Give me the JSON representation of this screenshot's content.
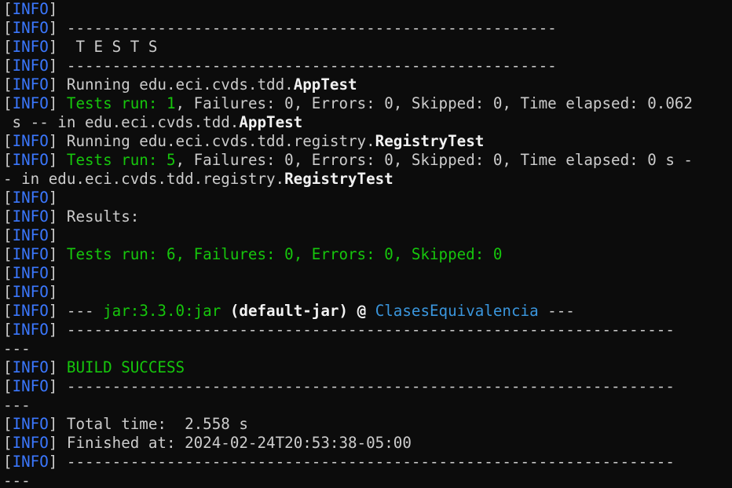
{
  "window": {
    "title": ""
  },
  "log_tag": "INFO",
  "colors": {
    "background": "#0c0c0c",
    "default_text": "#cccccc",
    "bright_text": "#f2f2f2",
    "info_tag": "#3b78ff",
    "success_green": "#16c60c",
    "artifact_cyan": "#3a96dd"
  },
  "lines": [
    {
      "tag": true,
      "segments": []
    },
    {
      "tag": true,
      "segments": [
        {
          "text": " ------------------------------------------------------",
          "style": "default"
        }
      ]
    },
    {
      "tag": true,
      "segments": [
        {
          "text": "  T E S T S",
          "style": "default"
        }
      ]
    },
    {
      "tag": true,
      "segments": [
        {
          "text": " ------------------------------------------------------",
          "style": "default"
        }
      ]
    },
    {
      "tag": true,
      "segments": [
        {
          "text": " Running edu.eci.cvds.tdd.",
          "style": "default"
        },
        {
          "text": "AppTest",
          "style": "bold"
        }
      ]
    },
    {
      "tag": true,
      "segments": [
        {
          "text": " Tests run: 1",
          "style": "green"
        },
        {
          "text": ", Failures: 0, Errors: 0, Skipped: 0, Time elapsed: 0.062",
          "style": "default"
        }
      ]
    },
    {
      "tag": false,
      "segments": [
        {
          "text": " s -- in edu.eci.cvds.tdd.",
          "style": "default"
        },
        {
          "text": "AppTest",
          "style": "bold"
        }
      ]
    },
    {
      "tag": true,
      "segments": [
        {
          "text": " Running edu.eci.cvds.tdd.registry.",
          "style": "default"
        },
        {
          "text": "RegistryTest",
          "style": "bold"
        }
      ]
    },
    {
      "tag": true,
      "segments": [
        {
          "text": " Tests run: 5",
          "style": "green"
        },
        {
          "text": ", Failures: 0, Errors: 0, Skipped: 0, Time elapsed: 0 s -",
          "style": "default"
        }
      ]
    },
    {
      "tag": false,
      "segments": [
        {
          "text": "- in edu.eci.cvds.tdd.registry.",
          "style": "default"
        },
        {
          "text": "RegistryTest",
          "style": "bold"
        }
      ]
    },
    {
      "tag": true,
      "segments": []
    },
    {
      "tag": true,
      "segments": [
        {
          "text": " Results:",
          "style": "default"
        }
      ]
    },
    {
      "tag": true,
      "segments": []
    },
    {
      "tag": true,
      "segments": [
        {
          "text": " Tests run: 6, Failures: 0, Errors: 0, Skipped: 0",
          "style": "green"
        }
      ]
    },
    {
      "tag": true,
      "segments": []
    },
    {
      "tag": true,
      "segments": []
    },
    {
      "tag": true,
      "segments": [
        {
          "text": " --- ",
          "style": "default"
        },
        {
          "text": "jar:3.3.0:jar",
          "style": "green"
        },
        {
          "text": " (default-jar) @ ",
          "style": "bold"
        },
        {
          "text": "ClasesEquivalencia",
          "style": "cyan"
        },
        {
          "text": " ---",
          "style": "default"
        }
      ]
    },
    {
      "tag": true,
      "segments": [
        {
          "text": " -------------------------------------------------------------------",
          "style": "default"
        }
      ]
    },
    {
      "tag": false,
      "segments": [
        {
          "text": "---",
          "style": "default"
        }
      ]
    },
    {
      "tag": true,
      "segments": [
        {
          "text": " BUILD SUCCESS",
          "style": "green"
        }
      ]
    },
    {
      "tag": true,
      "segments": [
        {
          "text": " -------------------------------------------------------------------",
          "style": "default"
        }
      ]
    },
    {
      "tag": false,
      "segments": [
        {
          "text": "---",
          "style": "default"
        }
      ]
    },
    {
      "tag": true,
      "segments": [
        {
          "text": " Total time:  2.558 s",
          "style": "default"
        }
      ]
    },
    {
      "tag": true,
      "segments": [
        {
          "text": " Finished at: 2024-02-24T20:53:38-05:00",
          "style": "default"
        }
      ]
    },
    {
      "tag": true,
      "segments": [
        {
          "text": " -------------------------------------------------------------------",
          "style": "default"
        }
      ]
    },
    {
      "tag": false,
      "segments": [
        {
          "text": "---",
          "style": "default"
        }
      ]
    }
  ]
}
